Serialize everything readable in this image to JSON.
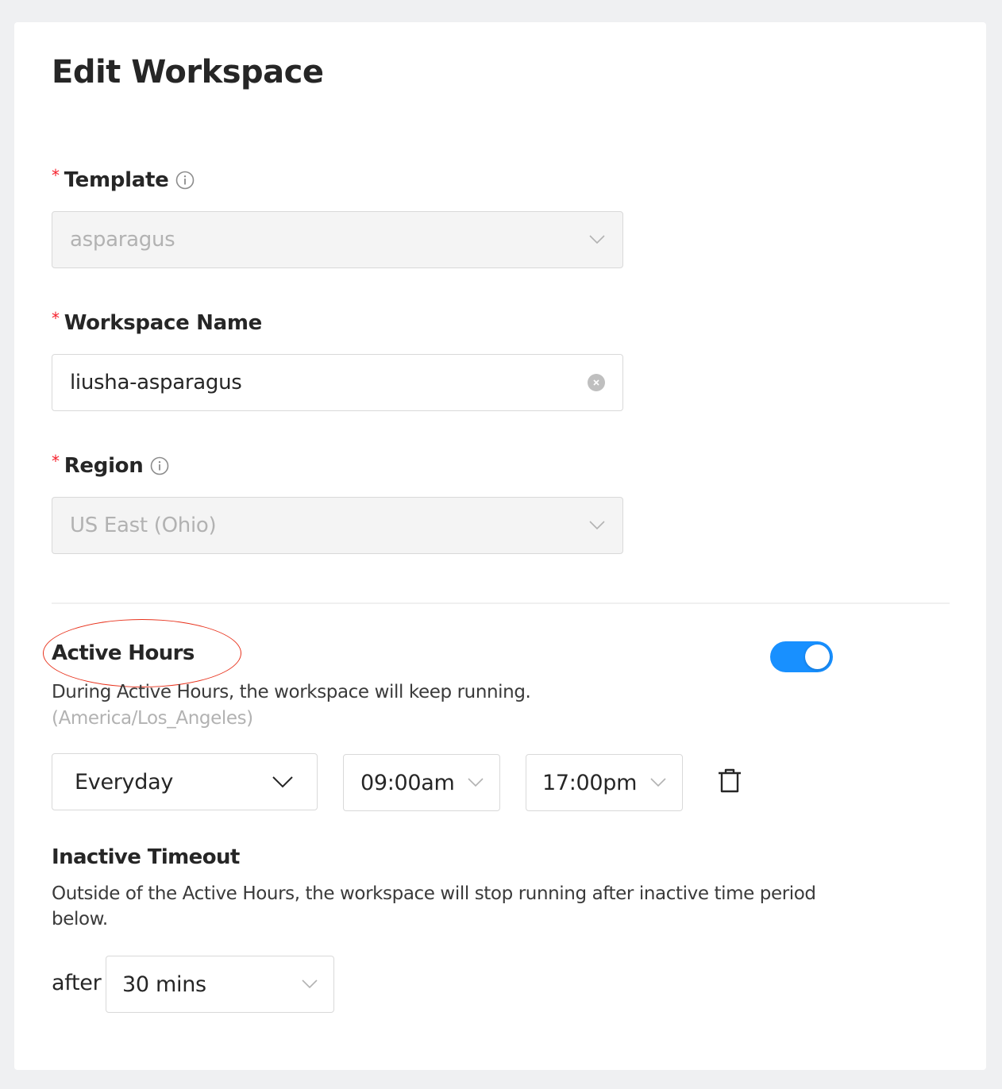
{
  "page": {
    "title": "Edit Workspace"
  },
  "form": {
    "required_mark": "*",
    "template": {
      "label": "Template",
      "value": "asparagus",
      "disabled": true
    },
    "workspace_name": {
      "label": "Workspace Name",
      "value": "liusha-asparagus"
    },
    "region": {
      "label": "Region",
      "value": "US East (Ohio)",
      "disabled": true
    }
  },
  "active_hours": {
    "title": "Active Hours",
    "description": "During Active Hours, the workspace will keep running.",
    "timezone": "(America/Los_Angeles)",
    "enabled": true,
    "accent_color": "#1890ff",
    "schedule": {
      "days": "Everyday",
      "start": "09:00am",
      "end": "17:00pm"
    }
  },
  "inactive_timeout": {
    "title": "Inactive Timeout",
    "description_line1": "Outside of the Active Hours, the workspace will stop running after inactive time period",
    "description_line2": "below.",
    "after_label": "after",
    "value": "30 mins"
  },
  "icons": {
    "info": "info-circle-icon",
    "chevron": "chevron-down-icon",
    "clear": "clear-circle-icon",
    "delete": "trash-icon"
  }
}
